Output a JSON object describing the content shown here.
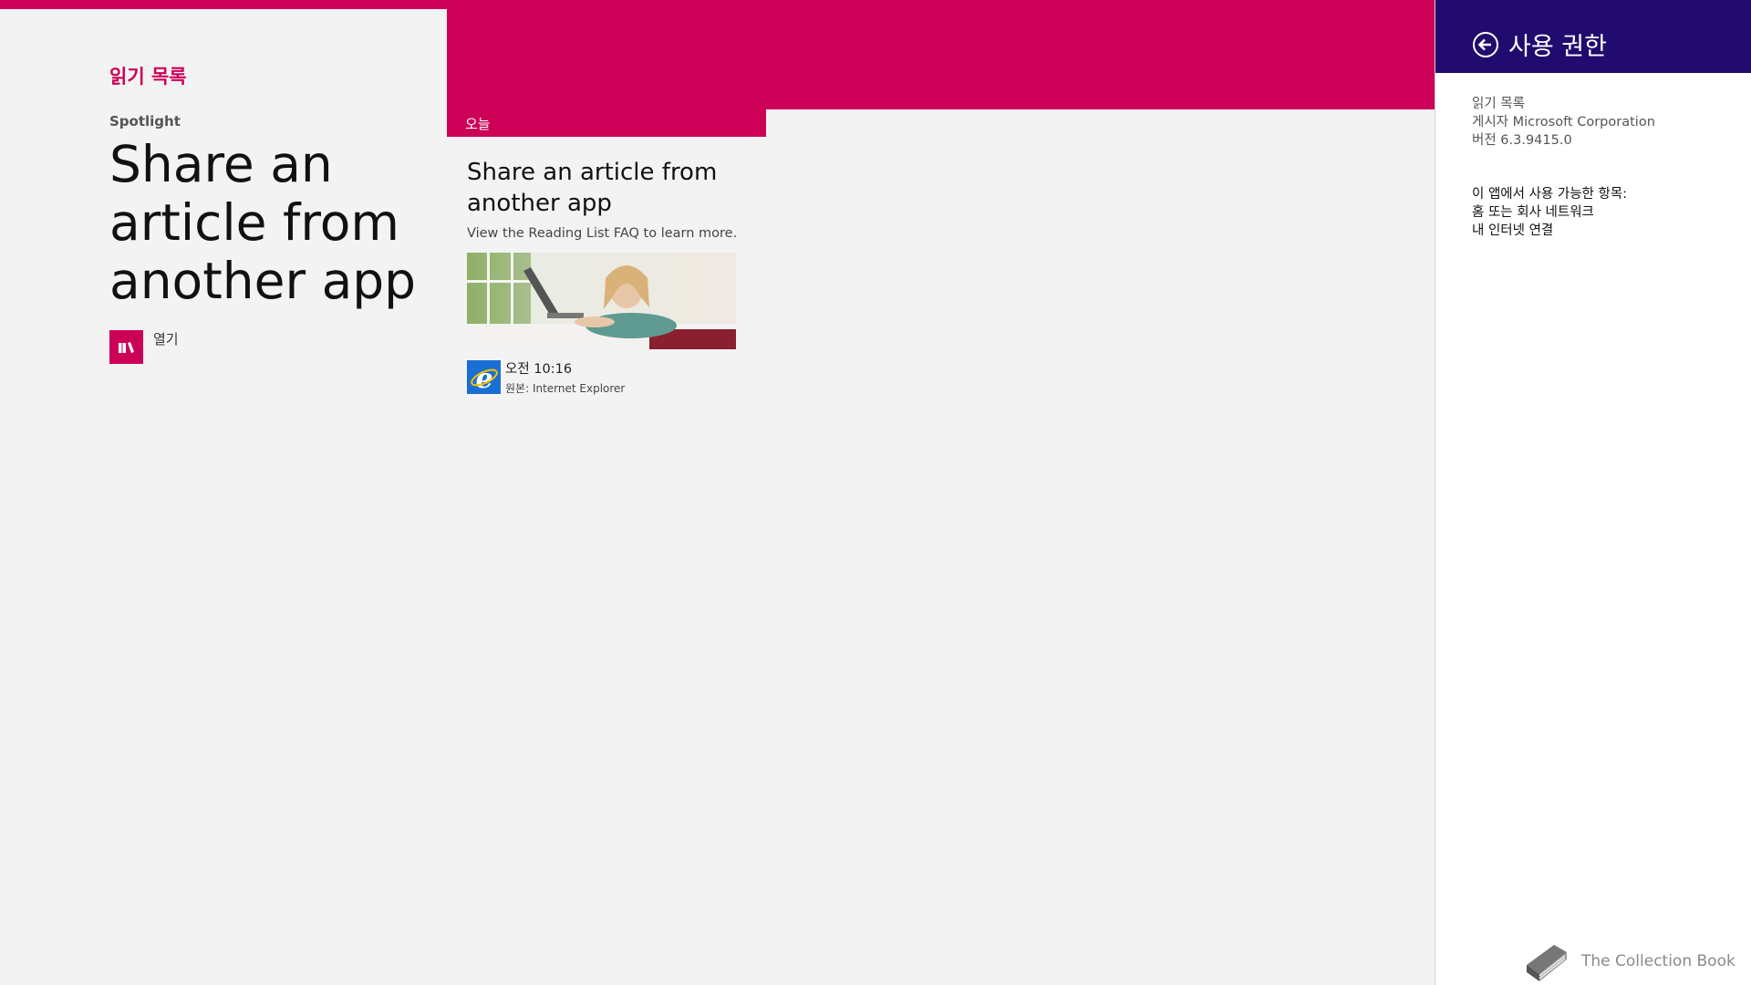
{
  "app": {
    "title": "읽기 목록",
    "accent_color": "#cd0058"
  },
  "spotlight": {
    "label": "Spotlight",
    "headline": "Share an article from another app",
    "open_label": "열기",
    "open_icon": "reading-list-icon"
  },
  "today_section": {
    "label": "오늘",
    "card": {
      "title": "Share an article from another app",
      "description": "View the Reading List FAQ to learn more.",
      "image": "woman-with-laptop-photo",
      "time": "오전 10:16",
      "source": "원본: Internet Explorer",
      "source_icon": "internet-explorer-icon"
    }
  },
  "permissions_panel": {
    "header_color": "#220b6e",
    "back_icon": "back-arrow-icon",
    "title": "사용 권한",
    "app_name": "읽기 목록",
    "publisher": "게시자 Microsoft Corporation",
    "version": "버전 6.3.9415.0",
    "access_heading": "이 앱에서 사용 가능한 항목:",
    "access_items": [
      "홈 또는 회사 네트워크",
      "내 인터넷 연결"
    ]
  },
  "watermark": {
    "text": "The Collection Book",
    "icon": "book-icon"
  }
}
